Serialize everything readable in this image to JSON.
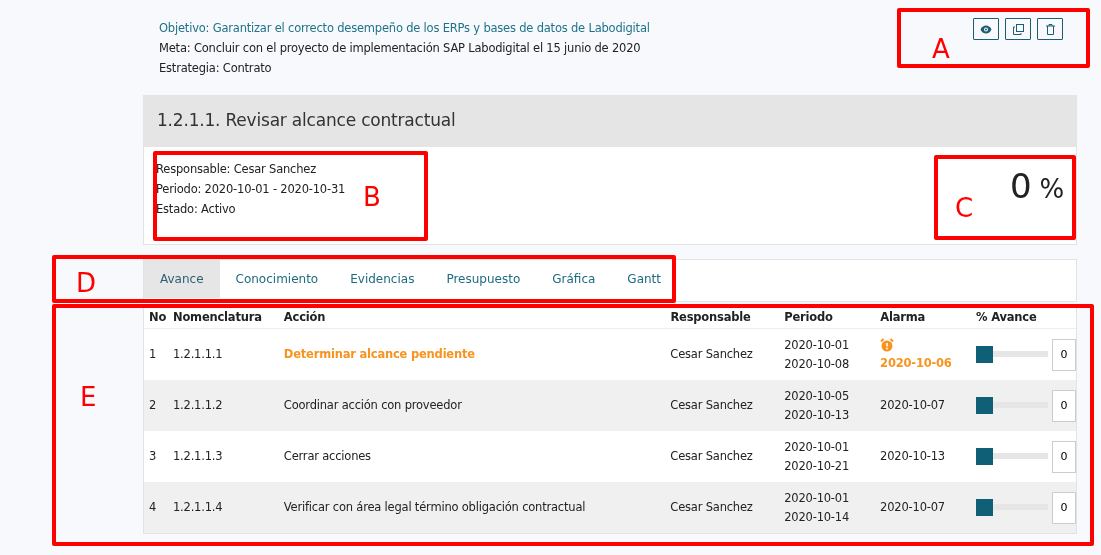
{
  "header": {
    "objective": "Objetivo: Garantizar el correcto desempeño de los ERPs y bases de datos de Labodigital",
    "goal": "Meta: Concluir con el proyecto de implementación SAP Labodigital el 15 junio de 2020",
    "strategy": "Estrategia: Contrato",
    "actions": [
      {
        "kind": "view"
      },
      {
        "kind": "copy"
      },
      {
        "kind": "delete"
      }
    ]
  },
  "task": {
    "title": "1.2.1.1. Revisar alcance contractual",
    "details": [
      "Responsable: Cesar Sanchez",
      "Periodo: 2020-10-01 - 2020-10-31",
      "Estado: Activo"
    ],
    "percent": "0",
    "percent_sign": "%"
  },
  "tabs": [
    {
      "label": "Avance",
      "selected": true
    },
    {
      "label": "Conocimiento",
      "selected": false
    },
    {
      "label": "Evidencias",
      "selected": false
    },
    {
      "label": "Presupuesto",
      "selected": false
    },
    {
      "label": "Gráfica",
      "selected": false
    },
    {
      "label": "Gantt",
      "selected": false
    }
  ],
  "table": {
    "columns": [
      "No",
      "Nomenclatura",
      "Acción",
      "Responsable",
      "Periodo",
      "Alarma",
      "% Avance"
    ],
    "rows": [
      {
        "no": "1",
        "code": "1.2.1.1.1",
        "action": "Determinar alcance pendiente",
        "owner": "Cesar Sanchez",
        "start": "2020-10-01",
        "end": "2020-10-08",
        "alarm": "2020-10-06",
        "overdue": true,
        "level": 0,
        "value": "0"
      },
      {
        "no": "2",
        "code": "1.2.1.1.2",
        "action": "Coordinar acción con proveedor",
        "owner": "Cesar Sanchez",
        "start": "2020-10-05",
        "end": "2020-10-13",
        "alarm": "2020-10-07",
        "overdue": false,
        "level": 0,
        "value": "0"
      },
      {
        "no": "3",
        "code": "1.2.1.1.3",
        "action": "Cerrar acciones",
        "owner": "Cesar Sanchez",
        "start": "2020-10-01",
        "end": "2020-10-21",
        "alarm": "2020-10-13",
        "overdue": false,
        "level": 0,
        "value": "0"
      },
      {
        "no": "4",
        "code": "1.2.1.1.4",
        "action": "Verificar con área legal término obligación contractual",
        "owner": "Cesar Sanchez",
        "start": "2020-10-01",
        "end": "2020-10-14",
        "alarm": "2020-10-07",
        "overdue": false,
        "level": 0,
        "value": "0"
      }
    ]
  },
  "annotations": [
    {
      "label": "A"
    },
    {
      "label": "B"
    },
    {
      "label": "C"
    },
    {
      "label": "D"
    },
    {
      "label": "E"
    }
  ]
}
